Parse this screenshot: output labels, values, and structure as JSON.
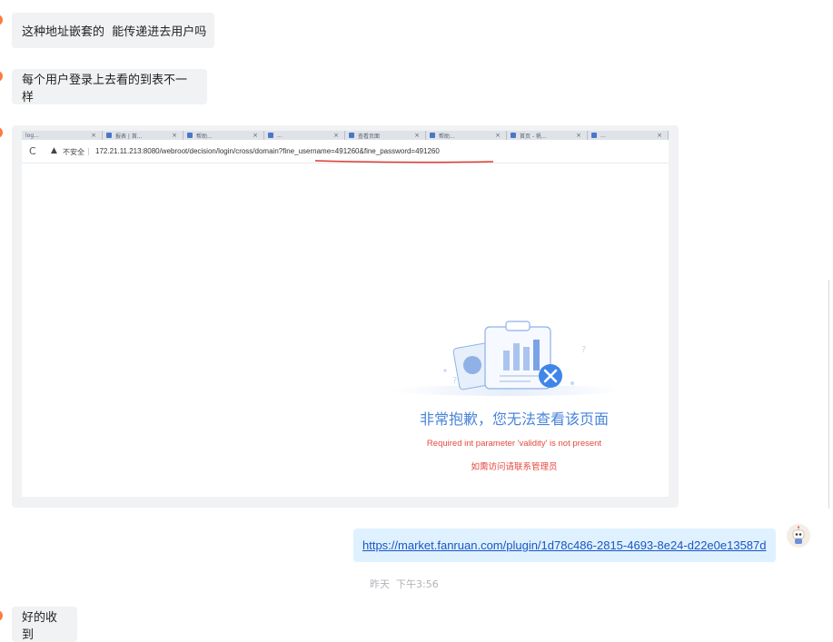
{
  "messages": {
    "m1": "这种地址嵌套的  能传递进去用户吗",
    "m2": "每个用户登录上去看的到表不一样",
    "m5": "好的收到"
  },
  "screenshot": {
    "tabs": [
      "log...",
      "报表 | 首...",
      "帮助...",
      "...",
      "查看页面",
      "帮助...",
      "首页 - 帆...",
      "..."
    ],
    "reload_icon": "reload-icon",
    "insecure_label": "不安全",
    "url": "172.21.11.213:8080/webroot/decision/login/cross/domain?fine_username=491260&fine_password=491260",
    "error_title": "非常抱歉，您无法查看该页面",
    "error_detail": "Required int parameter 'validity' is not present",
    "error_contact": "如需访问请联系管理员"
  },
  "link_message": {
    "url": "https://market.fanruan.com/plugin/1d78c486-2815-4693-8e24-d22e0e13587d"
  },
  "timestamp": "昨天  下午3:56",
  "colors": {
    "accent_link": "#1a55c4",
    "error_title": "#4a84d8",
    "error_detail": "#e4483f",
    "bubble_left": "#f1f2f4",
    "bubble_right": "#dff1ff",
    "avatar_dot": "#ff7a3d",
    "red_underline": "#e0392f"
  }
}
